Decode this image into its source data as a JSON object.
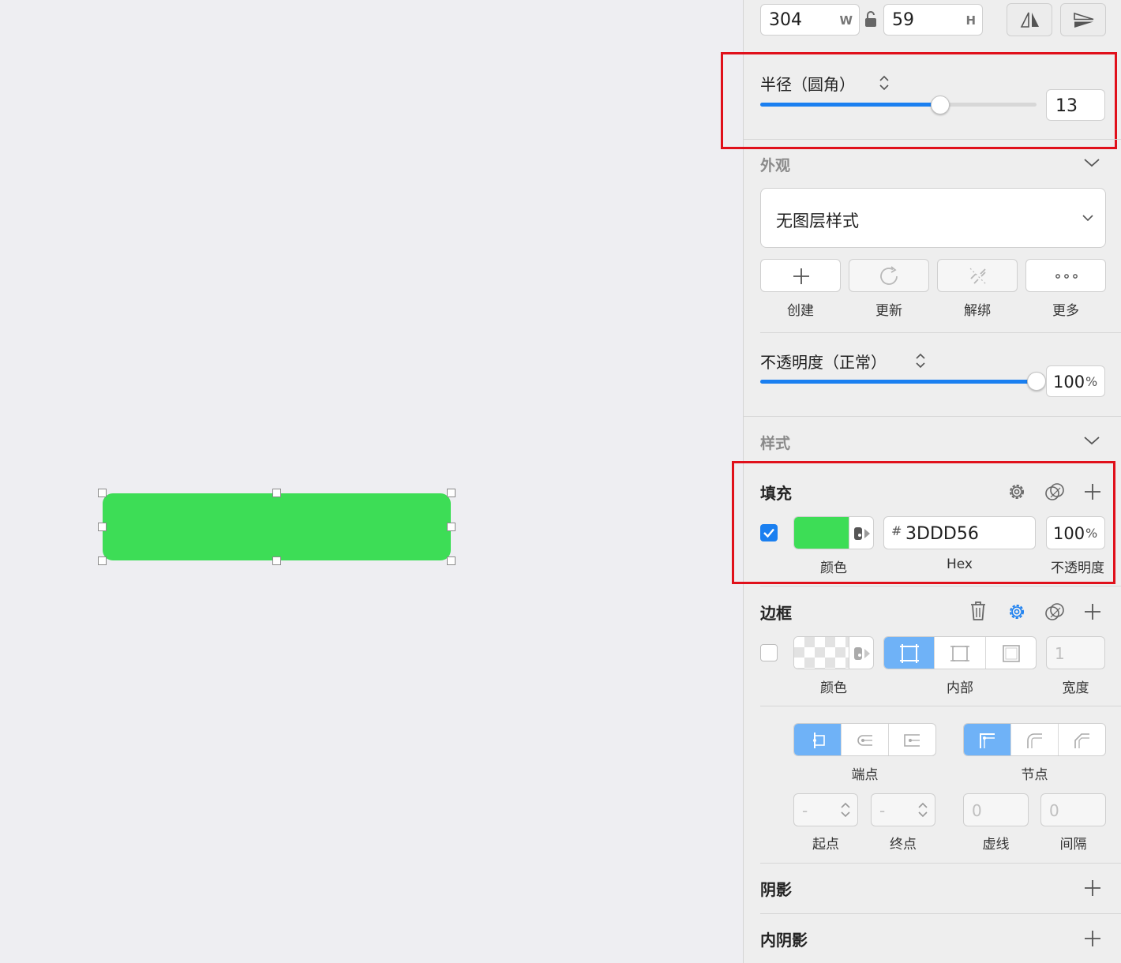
{
  "size": {
    "width": "304",
    "height": "59",
    "w_suffix": "W",
    "h_suffix": "H"
  },
  "radius": {
    "label": "半径（圆角）",
    "value": "13",
    "slider_fraction": 0.65
  },
  "appearance": {
    "section_label": "外观",
    "layer_style": "无图层样式",
    "actions": [
      {
        "label": "创建",
        "icon": "plus-icon"
      },
      {
        "label": "更新",
        "icon": "refresh-icon"
      },
      {
        "label": "解绑",
        "icon": "unlink-icon"
      },
      {
        "label": "更多",
        "icon": "more-icon"
      }
    ]
  },
  "opacity": {
    "label": "不透明度（正常）",
    "value": "100",
    "unit": "%",
    "slider_fraction": 1.0
  },
  "style_section": {
    "label": "样式"
  },
  "fill": {
    "title": "填充",
    "enabled": true,
    "color_hex": "#3DDD56",
    "hash": "#",
    "hex": "3DDD56",
    "opacity": "100",
    "unit": "%",
    "captions": {
      "color": "颜色",
      "hex": "Hex",
      "opacity": "不透明度"
    }
  },
  "border": {
    "title": "边框",
    "enabled": false,
    "width_placeholder": "1",
    "captions": {
      "color": "颜色",
      "position": "内部",
      "width": "宽度"
    }
  },
  "line": {
    "ends_label": "端点",
    "joins_label": "节点",
    "start_value": "-",
    "end_value": "-",
    "dash_value": "0",
    "gap_value": "0",
    "captions": {
      "start": "起点",
      "end": "终点",
      "dash": "虚线",
      "gap": "间隔"
    }
  },
  "shadow": {
    "title": "阴影"
  },
  "inner_shadow": {
    "title": "内阴影"
  },
  "colors": {
    "accent": "#1a7ff0",
    "segment_active": "#6fb2f7",
    "highlight_box": "#e0101b"
  }
}
